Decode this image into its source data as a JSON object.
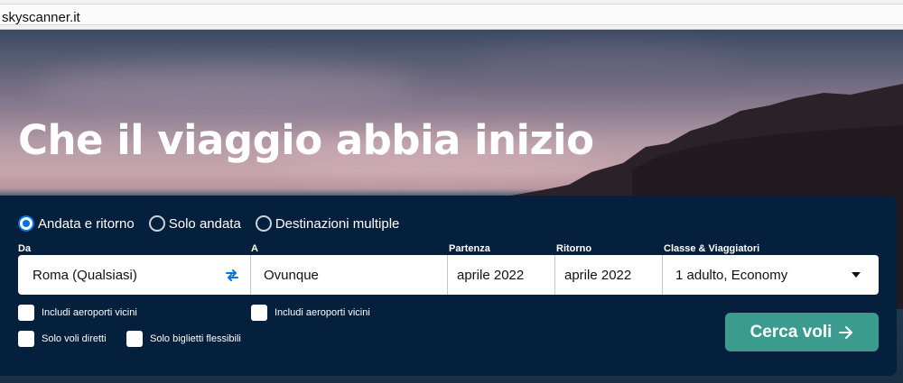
{
  "browser": {
    "url": "skyscanner.it"
  },
  "hero": {
    "title": "Che il viaggio abbia inizio"
  },
  "search": {
    "trip_types": [
      {
        "label": "Andata e ritorno",
        "selected": true
      },
      {
        "label": "Solo andata",
        "selected": false
      },
      {
        "label": "Destinazioni multiple",
        "selected": false
      }
    ],
    "labels": {
      "from": "Da",
      "to": "A",
      "departure": "Partenza",
      "return": "Ritorno",
      "class": "Classe & Viaggiatori"
    },
    "values": {
      "from": "Roma (Qualsiasi)",
      "to": "Ovunque",
      "departure": "aprile 2022",
      "return": "aprile 2022",
      "class": "1 adulto, Economy"
    },
    "checkboxes": {
      "nearby_from": "Includi aeroporti vicini",
      "nearby_to": "Includi aeroporti vicini",
      "direct": "Solo voli diretti",
      "flexible": "Solo biglietti flessibili"
    },
    "submit_label": "Cerca voli",
    "colors": {
      "accent": "#0770e3",
      "submit": "#3b9b8f",
      "panel": "#05203c"
    }
  },
  "icons": {
    "swap": "swap-arrows-icon",
    "dropdown": "caret-down-icon",
    "submit_arrow": "arrow-right-icon"
  }
}
